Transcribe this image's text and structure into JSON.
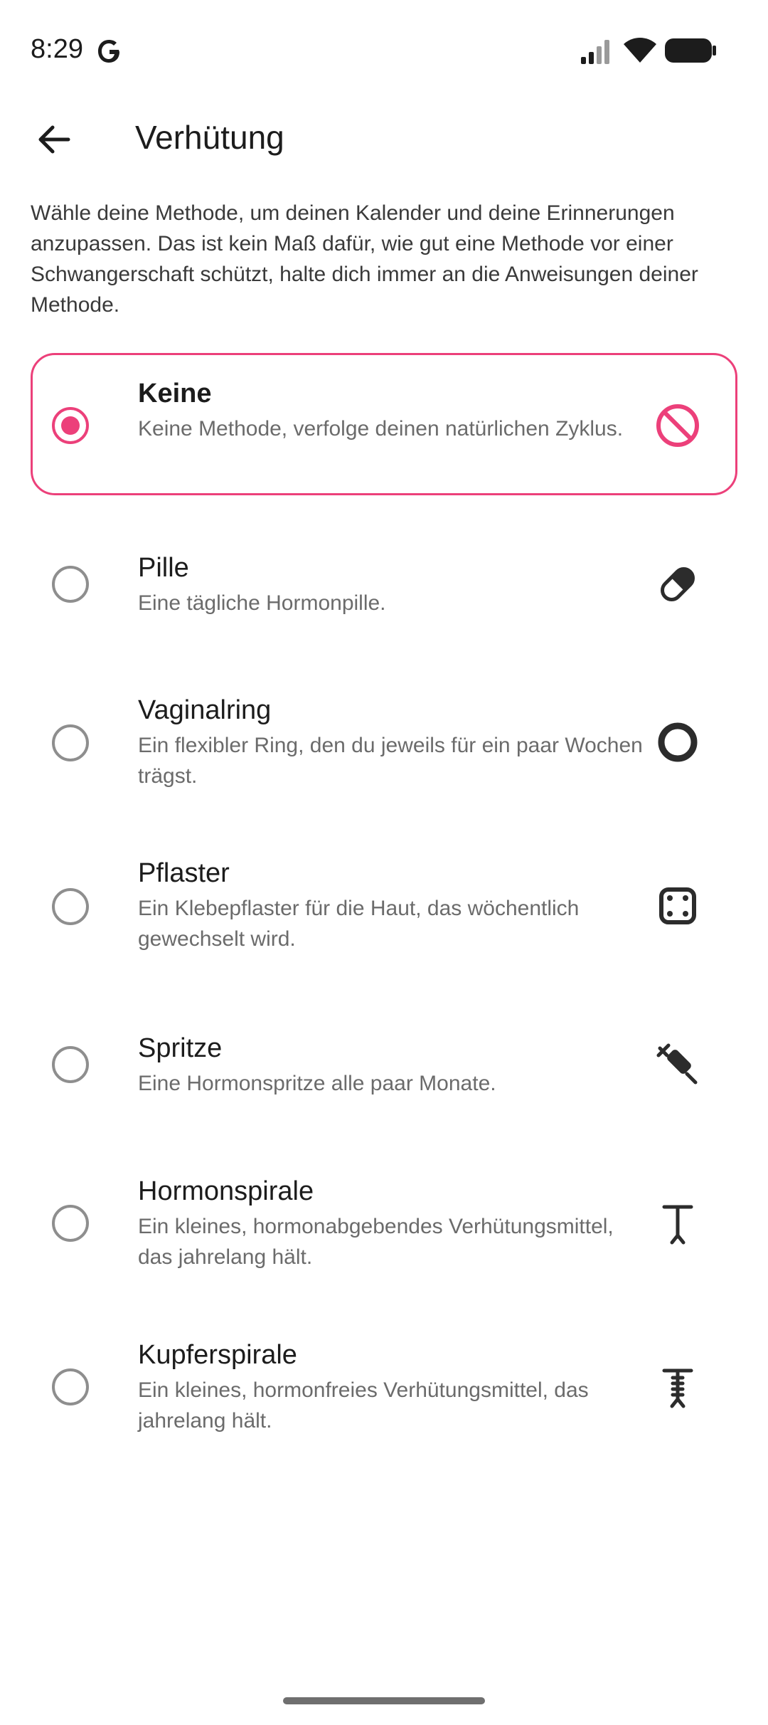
{
  "status_bar": {
    "time": "8:29"
  },
  "header": {
    "title": "Verhütung"
  },
  "description": "Wähle deine Methode, um deinen Kalender und deine Erinnerungen anzupassen. Das ist kein Maß dafür, wie gut eine Methode vor einer Schwangerschaft schützt,  halte dich immer an die Anweisungen deiner Methode.",
  "options": [
    {
      "title": "Keine",
      "description": "Keine Methode,  verfolge deinen natürlichen Zyklus.",
      "selected": true,
      "icon": "no-entry-icon"
    },
    {
      "title": "Pille",
      "description": "Eine tägliche Hormonpille.",
      "selected": false,
      "icon": "pill-icon"
    },
    {
      "title": "Vaginalring",
      "description": "Ein flexibler Ring, den du jeweils für ein paar Wochen trägst.",
      "selected": false,
      "icon": "ring-icon"
    },
    {
      "title": "Pflaster",
      "description": "Ein Klebepflaster für die Haut, das wöchentlich gewechselt wird.",
      "selected": false,
      "icon": "patch-icon"
    },
    {
      "title": "Spritze",
      "description": "Eine Hormonspritze alle paar Monate.",
      "selected": false,
      "icon": "syringe-icon"
    },
    {
      "title": "Hormonspirale",
      "description": "Ein kleines, hormonabgebendes Verhütungsmittel, das jahrelang hält.",
      "selected": false,
      "icon": "hormonal-iud-icon"
    },
    {
      "title": "Kupferspirale",
      "description": "Ein kleines, hormonfreies Verhütungsmittel, das jahrelang hält.",
      "selected": false,
      "icon": "copper-iud-icon"
    }
  ],
  "colors": {
    "accent": "#ec407a",
    "text": "#1c1c1c",
    "secondary_text": "#6b6b6b"
  }
}
